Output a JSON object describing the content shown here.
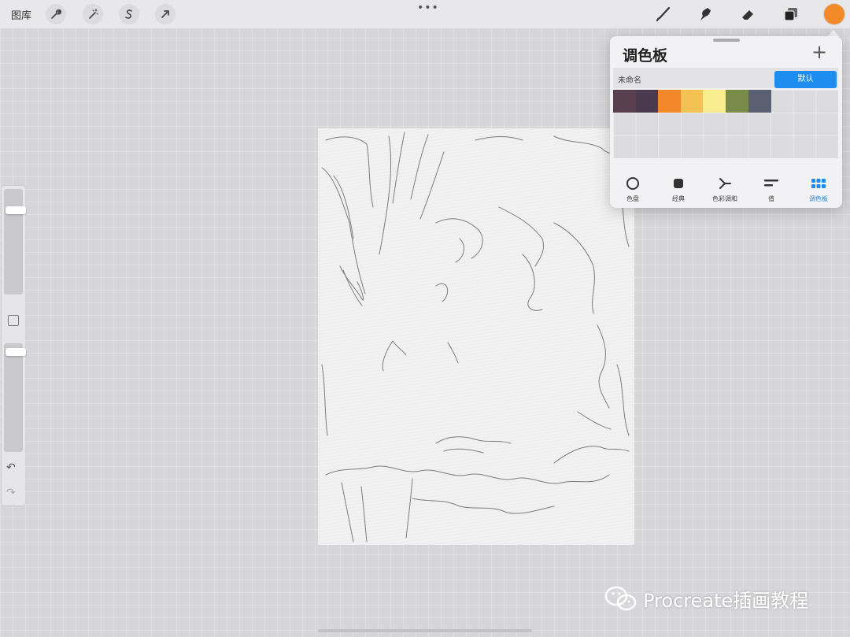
{
  "toolbar": {
    "gallery_label": "图库",
    "actions_icon": "wrench-icon",
    "adjustments_icon": "magic-wand-icon",
    "selection_icon": "selection-s-icon",
    "transform_icon": "arrow-cursor-icon",
    "more_dots": "•••",
    "brush_icon": "brush-icon",
    "smudge_icon": "smudge-icon",
    "eraser_icon": "eraser-icon",
    "layers_icon": "layers-icon",
    "current_color": "#f28a2a"
  },
  "sidebar": {
    "brush_size_level": 0.18,
    "opacity_level": 0.05,
    "undo_symbol": "↶",
    "redo_symbol": "↷"
  },
  "palette_panel": {
    "title": "调色板",
    "add_symbol": "+",
    "palette_name": "未命名",
    "default_button": "默认",
    "swatches": [
      "#5a3f4e",
      "#4a3a50",
      "#f3882a",
      "#f4c252",
      "#f8ee90",
      "#7a8a4a",
      "#5a6072"
    ],
    "tabs": [
      {
        "label": "色盘",
        "icon": "disc-icon"
      },
      {
        "label": "经典",
        "icon": "classic-square-icon"
      },
      {
        "label": "色彩调和",
        "icon": "harmony-icon"
      },
      {
        "label": "值",
        "icon": "value-sliders-icon"
      },
      {
        "label": "调色板",
        "icon": "palette-grid-icon",
        "active": true
      }
    ]
  },
  "watermark": {
    "text": "Procreate插画教程"
  }
}
